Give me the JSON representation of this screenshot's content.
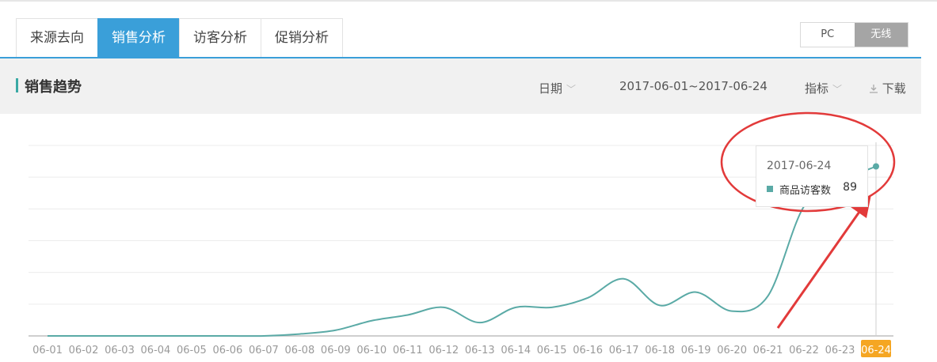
{
  "tabs": [
    {
      "label": "来源去向",
      "active": false
    },
    {
      "label": "销售分析",
      "active": true
    },
    {
      "label": "访客分析",
      "active": false
    },
    {
      "label": "促销分析",
      "active": false
    }
  ],
  "device_toggle": {
    "pc": "PC",
    "wireless": "无线",
    "selected": "无线"
  },
  "panel": {
    "title": "销售趋势",
    "date_label": "日期",
    "date_range": "2017-06-01~2017-06-24",
    "metric_label": "指标",
    "download_label": "下载"
  },
  "tooltip": {
    "date": "2017-06-24",
    "series": "商品访客数",
    "value": "89"
  },
  "colors": {
    "accent": "#3a9fd9",
    "line": "#5aaaa6",
    "highlight_tick": "#f5a623",
    "annotation": "#e83a3a"
  },
  "icons": {
    "chevron": "chevron-down-icon",
    "download": "download-icon"
  },
  "chart_data": {
    "type": "line",
    "categories": [
      "06-01",
      "06-02",
      "06-03",
      "06-04",
      "06-05",
      "06-06",
      "06-07",
      "06-08",
      "06-09",
      "06-10",
      "06-11",
      "06-12",
      "06-13",
      "06-14",
      "06-15",
      "06-16",
      "06-17",
      "06-18",
      "06-19",
      "06-20",
      "06-21",
      "06-22",
      "06-23",
      "06-24"
    ],
    "series": [
      {
        "name": "商品访客数",
        "values": [
          0,
          0,
          0,
          0,
          0,
          0,
          0,
          1,
          3,
          8,
          11,
          15,
          7,
          15,
          15,
          20,
          30,
          16,
          23,
          13,
          21,
          68,
          81,
          89
        ]
      }
    ],
    "ylim": [
      0,
      100
    ],
    "highlighted_category": "06-24",
    "grid": true
  }
}
